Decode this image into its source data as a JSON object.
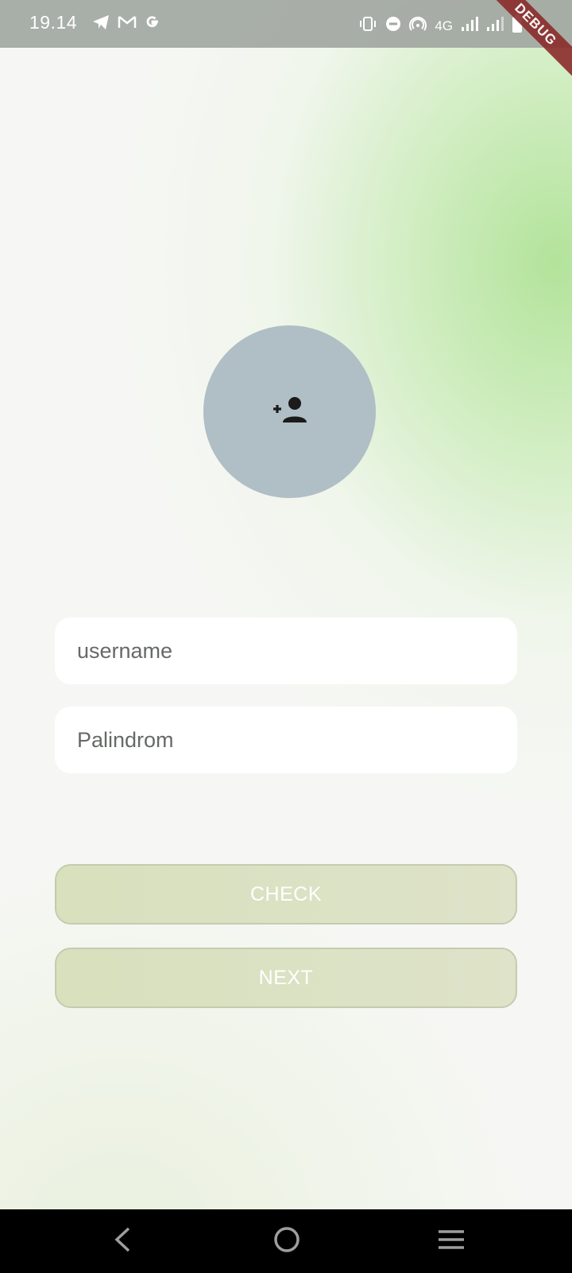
{
  "status_bar": {
    "time": "19.14",
    "network": "4G",
    "debug_banner": "DEBUG"
  },
  "avatar": {
    "icon": "person-add-icon"
  },
  "form": {
    "username_placeholder": "username",
    "palindrome_placeholder": "Palindrom"
  },
  "buttons": {
    "check_label": "CHECK",
    "next_label": "NEXT"
  },
  "nav_bar": {
    "back_icon": "back-chevron-icon",
    "home_icon": "home-circle-icon",
    "menu_icon": "menu-lines-icon"
  },
  "colors": {
    "avatar_bg": "#b0bec5",
    "button_bg": "#d8e0bd",
    "accent_green": "#afe296"
  }
}
